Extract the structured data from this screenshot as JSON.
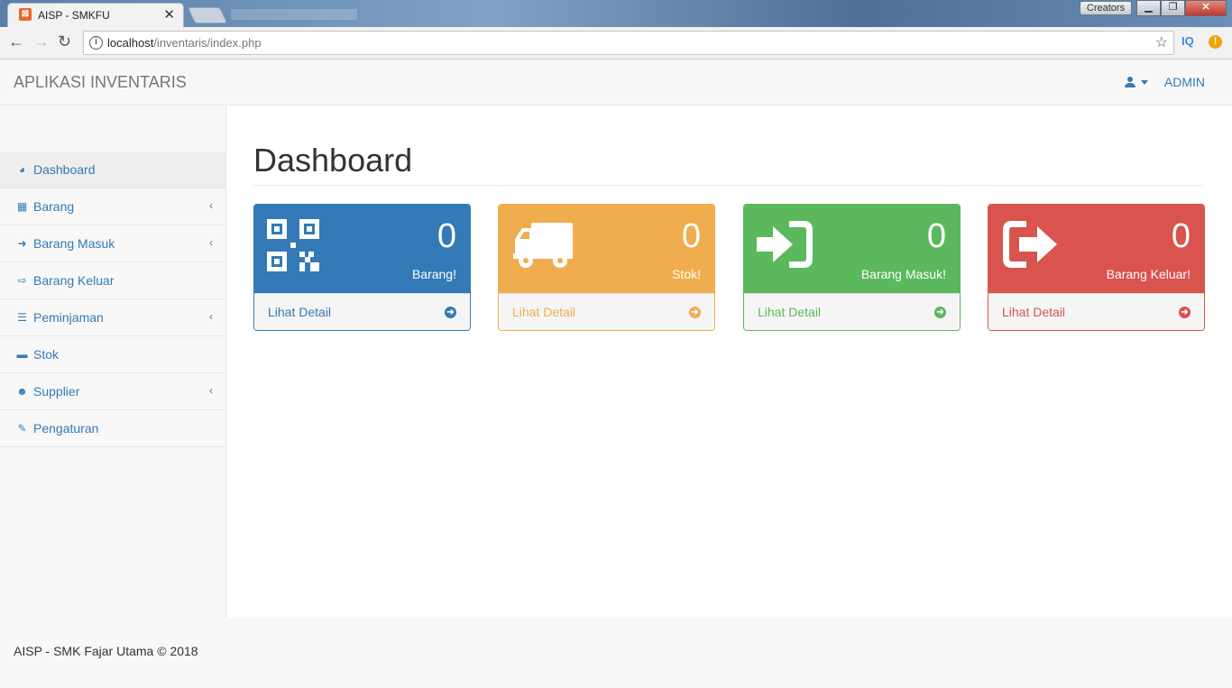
{
  "browser": {
    "tab_title": "AISP - SMKFU",
    "tab_close": "✕",
    "creators_label": "Creators",
    "url_host": "localhost",
    "url_path": "/inventaris/index.php",
    "ext_iq": "IQ",
    "ext_warn": "!"
  },
  "navbar": {
    "brand": "APLIKASI INVENTARIS",
    "user_label": "ADMIN"
  },
  "sidebar": {
    "items": [
      {
        "label": "Dashboard",
        "icon": "dashboard-icon",
        "glyph": "◕",
        "submenu": false
      },
      {
        "label": "Barang",
        "icon": "qrcode-icon",
        "glyph": "▦",
        "submenu": true
      },
      {
        "label": "Barang Masuk",
        "icon": "sign-in-icon",
        "glyph": "➜",
        "submenu": true
      },
      {
        "label": "Barang Keluar",
        "icon": "sign-out-icon",
        "glyph": "⇨",
        "submenu": false
      },
      {
        "label": "Peminjaman",
        "icon": "list-icon",
        "glyph": "☰",
        "submenu": true
      },
      {
        "label": "Stok",
        "icon": "truck-icon",
        "glyph": "▬",
        "submenu": false
      },
      {
        "label": "Supplier",
        "icon": "users-icon",
        "glyph": "☻",
        "submenu": true
      },
      {
        "label": "Pengaturan",
        "icon": "wrench-icon",
        "glyph": "✎",
        "submenu": false
      }
    ],
    "arrow_glyph": "‹"
  },
  "main": {
    "title": "Dashboard",
    "panels": [
      {
        "count": "0",
        "label": "Barang!",
        "link": "Lihat Detail",
        "color": "#337ab7",
        "icon": "qrcode-icon"
      },
      {
        "count": "0",
        "label": "Stok!",
        "link": "Lihat Detail",
        "color": "#f0ad4e",
        "icon": "truck-icon"
      },
      {
        "count": "0",
        "label": "Barang Masuk!",
        "link": "Lihat Detail",
        "color": "#5cb85c",
        "icon": "sign-in-icon"
      },
      {
        "count": "0",
        "label": "Barang Keluar!",
        "link": "Lihat Detail",
        "color": "#d9534f",
        "icon": "sign-out-icon"
      }
    ],
    "arrow_glyph": "➜"
  },
  "footer": {
    "text": "AISP - SMK Fajar Utama © 2018"
  }
}
